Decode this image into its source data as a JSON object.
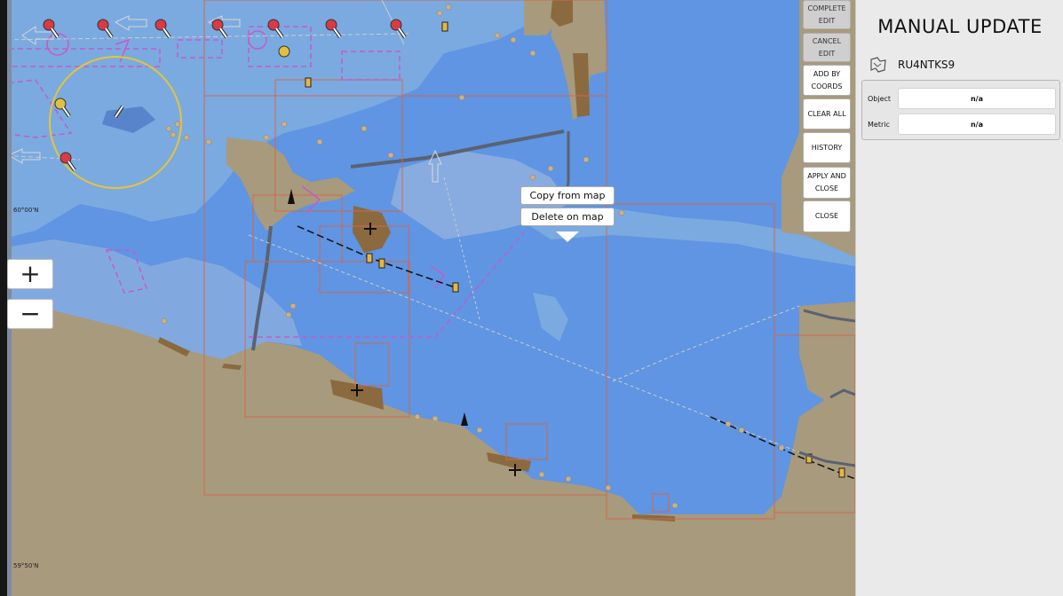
{
  "map": {
    "latitude_labels": [
      "60°00'N",
      "59°50'N"
    ],
    "zoom_in_label": "+",
    "zoom_out_label": "−",
    "colors": {
      "land": "#a89a7c",
      "deep_water": "#5f95e2",
      "shallow_water": "#7aaae0",
      "medium_water": "#82a9df",
      "cell_border": "#d2684c",
      "restricted_area": "#c65ac9"
    }
  },
  "context_menu": {
    "items": [
      "Copy from map",
      "Delete on map"
    ]
  },
  "toolbar": {
    "complete_edit": "COMPLETE EDIT",
    "cancel_edit": "CANCEL EDIT",
    "add_by_coords": "ADD BY COORDS",
    "clear_all": "CLEAR ALL",
    "history": "HISTORY",
    "apply_and_close": "APPLY AND CLOSE",
    "close": "CLOSE"
  },
  "panel": {
    "title": "MANUAL UPDATE",
    "cell_icon": "chart-cell-icon",
    "cell_name": "RU4NTKS9",
    "fields": {
      "object_label": "Object",
      "object_value": "n/a",
      "metric_label": "Metric",
      "metric_value": "n/a"
    }
  }
}
